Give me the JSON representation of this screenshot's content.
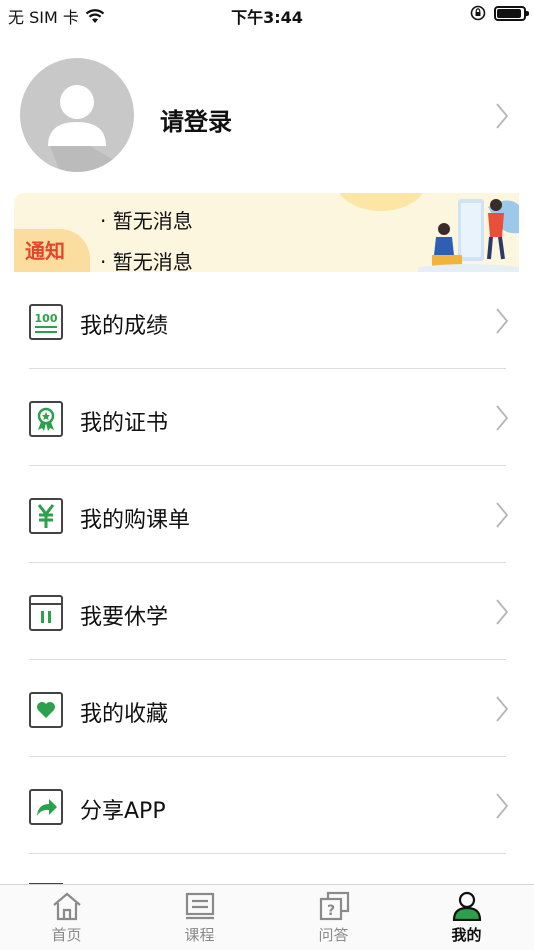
{
  "status_bar": {
    "carrier": "无 SIM 卡",
    "time": "下午3:44"
  },
  "profile": {
    "login_label": "请登录"
  },
  "notice": {
    "tag": "通知",
    "messages": [
      "· 暂无消息",
      "· 暂无消息"
    ]
  },
  "menu": [
    {
      "label": "我的成绩",
      "icon": "score-100-icon"
    },
    {
      "label": "我的证书",
      "icon": "certificate-icon"
    },
    {
      "label": "我的购课单",
      "icon": "yuan-icon"
    },
    {
      "label": "我要休学",
      "icon": "pause-icon"
    },
    {
      "label": "我的收藏",
      "icon": "heart-icon"
    },
    {
      "label": "分享APP",
      "icon": "share-icon"
    }
  ],
  "tabs": [
    {
      "label": "首页",
      "icon": "home-icon",
      "active": false
    },
    {
      "label": "课程",
      "icon": "course-icon",
      "active": false
    },
    {
      "label": "问答",
      "icon": "qa-icon",
      "active": false
    },
    {
      "label": "我的",
      "icon": "profile-icon",
      "active": true
    }
  ],
  "colors": {
    "accent_green": "#2aa14a",
    "notice_red": "#e5452c",
    "notice_bg": "#fdf6df"
  }
}
